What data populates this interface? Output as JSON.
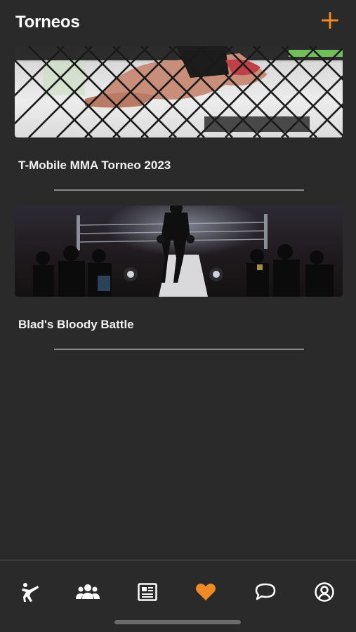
{
  "header": {
    "title": "Torneos",
    "add_icon": "plus-icon"
  },
  "tournaments": [
    {
      "title": "T-Mobile MMA Torneo 2023"
    },
    {
      "title": "Blad's Bloody Battle"
    }
  ],
  "tabbar": {
    "items": [
      {
        "icon": "martial-arts-icon"
      },
      {
        "icon": "group-icon"
      },
      {
        "icon": "news-icon"
      },
      {
        "icon": "heart-icon",
        "active": true
      },
      {
        "icon": "chat-bubble-icon"
      },
      {
        "icon": "account-circle-icon"
      }
    ]
  },
  "colors": {
    "background": "#2a2a2a",
    "accent": "#f08a24",
    "text": "#ffffff",
    "divider": "#8a8a8a"
  }
}
